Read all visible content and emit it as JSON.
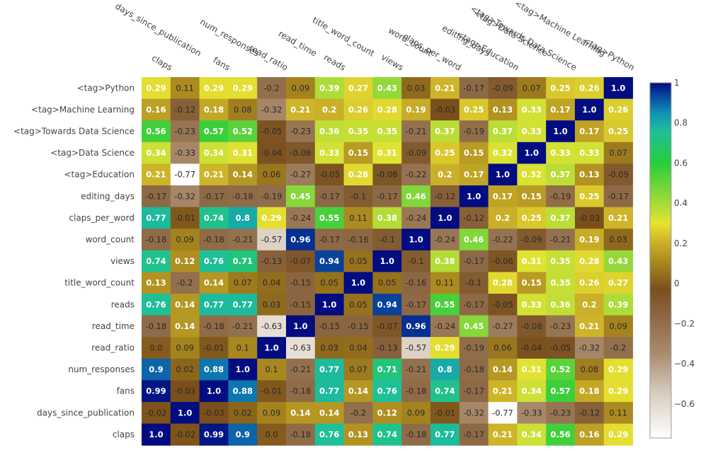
{
  "chart_data": {
    "type": "heatmap",
    "title": "",
    "xlabel": "",
    "ylabel": "",
    "x_categories": [
      "claps",
      "days_since_publication",
      "fans",
      "num_responses",
      "read_ratio",
      "read_time",
      "reads",
      "title_word_count",
      "views",
      "word_count",
      "claps_per_word",
      "editing_days",
      "<tag>Education",
      "<tag>Data Science",
      "<tag>Towards Data Science",
      "<tag>Machine Learning",
      "<tag>Python"
    ],
    "y_categories_top_to_bottom": [
      "<tag>Python",
      "<tag>Machine Learning",
      "<tag>Towards Data Science",
      "<tag>Data Science",
      "<tag>Education",
      "editing_days",
      "claps_per_word",
      "word_count",
      "views",
      "title_word_count",
      "reads",
      "read_time",
      "read_ratio",
      "num_responses",
      "fans",
      "days_since_publication",
      "claps"
    ],
    "values": [
      [
        0.29,
        0.11,
        0.29,
        0.29,
        -0.2,
        0.09,
        0.39,
        0.27,
        0.43,
        0.03,
        0.21,
        -0.17,
        -0.09,
        0.07,
        0.25,
        0.26,
        1.0
      ],
      [
        0.16,
        -0.12,
        0.18,
        0.08,
        -0.32,
        0.21,
        0.2,
        0.26,
        0.28,
        0.19,
        -0.03,
        0.25,
        0.13,
        0.33,
        0.17,
        1.0,
        0.26
      ],
      [
        0.56,
        -0.23,
        0.57,
        0.52,
        -0.05,
        -0.23,
        0.36,
        0.35,
        0.35,
        -0.21,
        0.37,
        -0.19,
        0.37,
        0.33,
        1.0,
        0.17,
        0.25
      ],
      [
        0.34,
        -0.33,
        0.34,
        0.31,
        -0.04,
        -0.08,
        0.33,
        0.15,
        0.31,
        -0.09,
        0.25,
        0.15,
        0.32,
        1.0,
        0.33,
        0.33,
        0.07
      ],
      [
        0.21,
        -0.77,
        0.21,
        0.14,
        0.06,
        -0.27,
        -0.05,
        0.28,
        -0.06,
        -0.22,
        0.2,
        0.17,
        1.0,
        0.32,
        0.37,
        0.13,
        -0.09
      ],
      [
        -0.17,
        -0.32,
        -0.17,
        -0.18,
        -0.19,
        0.45,
        -0.17,
        -0.1,
        -0.17,
        0.46,
        -0.12,
        1.0,
        0.17,
        0.15,
        -0.19,
        0.25,
        -0.17
      ],
      [
        0.77,
        -0.01,
        0.74,
        0.8,
        0.29,
        -0.24,
        0.55,
        0.11,
        0.38,
        -0.24,
        1.0,
        -0.12,
        0.2,
        0.25,
        0.37,
        -0.03,
        0.21
      ],
      [
        -0.18,
        0.09,
        -0.18,
        -0.21,
        -0.57,
        0.96,
        -0.17,
        -0.16,
        -0.1,
        1.0,
        -0.24,
        0.46,
        -0.22,
        -0.09,
        -0.21,
        0.19,
        0.03
      ],
      [
        0.74,
        0.12,
        0.76,
        0.71,
        -0.13,
        -0.07,
        0.94,
        0.05,
        1.0,
        -0.1,
        0.38,
        -0.17,
        -0.06,
        0.31,
        0.35,
        0.28,
        0.43
      ],
      [
        0.13,
        -0.2,
        0.14,
        0.07,
        0.04,
        -0.15,
        0.05,
        1.0,
        0.05,
        -0.16,
        0.11,
        -0.1,
        0.28,
        0.15,
        0.35,
        0.26,
        0.27
      ],
      [
        0.76,
        0.14,
        0.77,
        0.77,
        0.03,
        -0.15,
        1.0,
        0.05,
        0.94,
        -0.17,
        0.55,
        -0.17,
        -0.05,
        0.33,
        0.36,
        0.2,
        0.39
      ],
      [
        -0.18,
        0.14,
        -0.18,
        -0.21,
        -0.63,
        1.0,
        -0.15,
        -0.15,
        -0.07,
        0.96,
        -0.24,
        0.45,
        -0.27,
        -0.08,
        -0.23,
        0.21,
        0.09
      ],
      [
        0.0,
        0.09,
        -0.01,
        0.1,
        1.0,
        -0.63,
        0.03,
        0.04,
        -0.13,
        -0.57,
        0.29,
        -0.19,
        0.06,
        -0.04,
        -0.05,
        -0.32,
        -0.2
      ],
      [
        0.9,
        0.02,
        0.88,
        1.0,
        0.1,
        -0.21,
        0.77,
        0.07,
        0.71,
        -0.21,
        0.8,
        -0.18,
        0.14,
        0.31,
        0.52,
        0.08,
        0.29
      ],
      [
        0.99,
        -0.03,
        1.0,
        0.88,
        -0.01,
        -0.18,
        0.77,
        0.14,
        0.76,
        -0.18,
        0.74,
        -0.17,
        0.21,
        0.34,
        0.57,
        0.18,
        0.29
      ],
      [
        -0.02,
        1.0,
        -0.03,
        0.02,
        0.09,
        0.14,
        0.14,
        -0.2,
        0.12,
        0.09,
        -0.01,
        -0.32,
        -0.77,
        -0.33,
        -0.23,
        -0.12,
        0.11
      ],
      [
        1.0,
        -0.02,
        0.99,
        0.9,
        0.0,
        -0.18,
        0.76,
        0.13,
        0.74,
        -0.18,
        0.77,
        -0.17,
        0.21,
        0.34,
        0.56,
        0.16,
        0.29
      ]
    ],
    "value_range": [
      -0.77,
      1.0
    ],
    "colorscale": [
      [
        -0.77,
        "#ffffff"
      ],
      [
        -0.55,
        "#d9cdbf"
      ],
      [
        -0.35,
        "#a98c6e"
      ],
      [
        -0.15,
        "#8b6540"
      ],
      [
        -0.03,
        "#7a4f1c"
      ],
      [
        0.1,
        "#a8871f"
      ],
      [
        0.22,
        "#d0b82a"
      ],
      [
        0.3,
        "#e6e332"
      ],
      [
        0.42,
        "#9ad93a"
      ],
      [
        0.6,
        "#28cd3c"
      ],
      [
        0.76,
        "#1fbf98"
      ],
      [
        0.85,
        "#1090b8"
      ],
      [
        0.93,
        "#0a4aa0"
      ],
      [
        1.0,
        "#000c80"
      ]
    ],
    "colorbar": {
      "ticks": [
        1,
        0.8,
        0.6,
        0.4,
        0.2,
        0,
        -0.2,
        -0.4,
        -0.6
      ],
      "tick_labels": [
        "1",
        "0.8",
        "0.6",
        "0.4",
        "0.2",
        "0",
        "−0.2",
        "−0.4",
        "−0.6"
      ],
      "placement": "right"
    },
    "grid": false,
    "annotations": "cell values shown in each cell"
  }
}
